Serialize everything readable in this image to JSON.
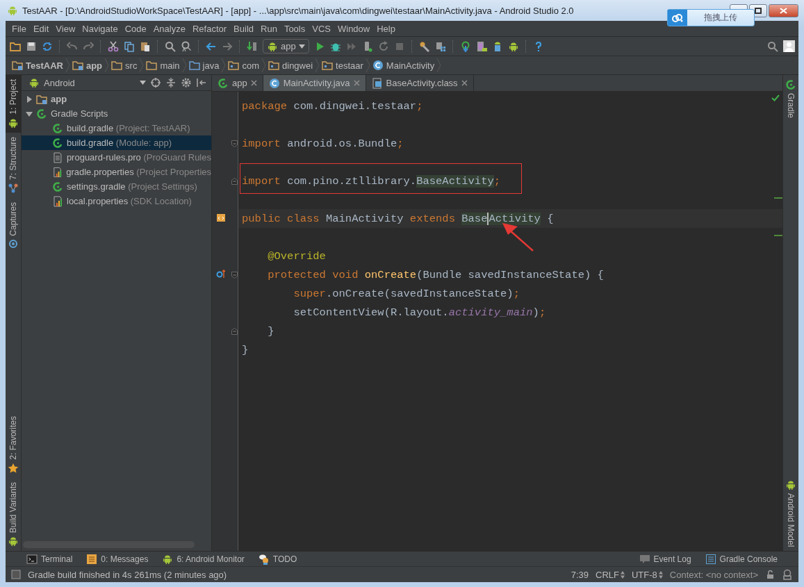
{
  "window": {
    "title": "TestAAR - [D:\\AndroidStudioWorkSpace\\TestAAR] - [app] - ...\\app\\src\\main\\java\\com\\dingwei\\testaar\\MainActivity.java - Android Studio 2.0",
    "upload_button": "拖拽上传"
  },
  "menu": [
    {
      "label": "File"
    },
    {
      "label": "Edit"
    },
    {
      "label": "View"
    },
    {
      "label": "Navigate"
    },
    {
      "label": "Code"
    },
    {
      "label": "Analyze"
    },
    {
      "label": "Refactor"
    },
    {
      "label": "Build"
    },
    {
      "label": "Run"
    },
    {
      "label": "Tools"
    },
    {
      "label": "VCS"
    },
    {
      "label": "Window"
    },
    {
      "label": "Help"
    }
  ],
  "toolbar": {
    "run_config": "app"
  },
  "breadcrumb": [
    {
      "label": "TestAAR",
      "kind": "module"
    },
    {
      "label": "app",
      "kind": "module"
    },
    {
      "label": "src",
      "kind": "folder"
    },
    {
      "label": "main",
      "kind": "folder"
    },
    {
      "label": "java",
      "kind": "source"
    },
    {
      "label": "com",
      "kind": "package"
    },
    {
      "label": "dingwei",
      "kind": "package"
    },
    {
      "label": "testaar",
      "kind": "package"
    },
    {
      "label": "MainActivity",
      "kind": "class"
    }
  ],
  "left_strip": {
    "top": [
      {
        "label": "1: Project",
        "kind": "android",
        "selected": true
      },
      {
        "label": "7: Structure",
        "kind": "structure",
        "selected": false
      },
      {
        "label": "Captures",
        "kind": "captures",
        "selected": false
      }
    ],
    "bottom": [
      {
        "label": "2: Favorites",
        "kind": "star",
        "selected": false
      },
      {
        "label": "Build Variants",
        "kind": "android",
        "selected": false
      }
    ]
  },
  "right_strip": {
    "top": [
      {
        "label": "Gradle",
        "kind": "gradle"
      }
    ],
    "bottom": [
      {
        "label": "Android Model",
        "kind": "android"
      }
    ]
  },
  "project_panel": {
    "view": "Android",
    "tree": [
      {
        "name": "app",
        "kind": "module",
        "expanded": false,
        "selected": false
      },
      {
        "name": "Gradle Scripts",
        "kind": "gradle",
        "expanded": true,
        "selected": false,
        "children": [
          {
            "name": "build.gradle",
            "hint": "(Project: TestAAR)",
            "kind": "gradle",
            "selected": false
          },
          {
            "name": "build.gradle",
            "hint": "(Module: app)",
            "kind": "gradle",
            "selected": true
          },
          {
            "name": "proguard-rules.pro",
            "hint": "(ProGuard Rules",
            "kind": "text",
            "selected": false
          },
          {
            "name": "gradle.properties",
            "hint": "(Project Properties",
            "kind": "properties",
            "selected": false
          },
          {
            "name": "settings.gradle",
            "hint": "(Project Settings)",
            "kind": "gradle",
            "selected": false
          },
          {
            "name": "local.properties",
            "hint": "(SDK Location)",
            "kind": "properties",
            "selected": false
          }
        ]
      }
    ]
  },
  "tabs": [
    {
      "label": "app",
      "kind": "gradle",
      "selected": false
    },
    {
      "label": "MainActivity.java",
      "kind": "class",
      "selected": true
    },
    {
      "label": "BaseActivity.class",
      "kind": "classfile",
      "selected": false
    }
  ],
  "code": [
    {
      "tokens": [
        {
          "text": "package ",
          "kind": "keyword"
        },
        {
          "text": "com.dingwei.testaar",
          "kind": "plain"
        },
        {
          "text": ";",
          "kind": "punct"
        }
      ]
    },
    {
      "blank_before": true,
      "fold_start": true,
      "tokens": [
        {
          "text": "import ",
          "kind": "keyword"
        },
        {
          "text": "android.os.Bundle",
          "kind": "plain"
        },
        {
          "text": ";",
          "kind": "punct"
        }
      ]
    },
    {
      "blank_before": true,
      "fold_end": true,
      "boxed": true,
      "tokens": [
        {
          "text": "import ",
          "kind": "keyword"
        },
        {
          "text": "com.pino.ztllibrary.",
          "kind": "plain"
        },
        {
          "text": "BaseActivity",
          "kind": "ref"
        },
        {
          "text": ";",
          "kind": "punct"
        }
      ]
    },
    {
      "blank_before": true,
      "current": true,
      "implements_marker": true,
      "pointer": true,
      "tokens": [
        {
          "text": "public class ",
          "kind": "keyword"
        },
        {
          "text": "MainActivity ",
          "kind": "plain"
        },
        {
          "text": "extends ",
          "kind": "keyword"
        },
        {
          "text": "Base",
          "kind": "ref"
        },
        {
          "text": "Activity",
          "kind": "ref",
          "caret_before": true
        },
        {
          "text": " {",
          "kind": "plain"
        }
      ]
    },
    {
      "blank_before": true,
      "tokens": [
        {
          "text": "    @Override",
          "kind": "annotation"
        }
      ]
    },
    {
      "fold_start": true,
      "override_marker": true,
      "tokens": [
        {
          "text": "    protected void ",
          "kind": "keyword"
        },
        {
          "text": "onCreate",
          "kind": "method"
        },
        {
          "text": "(Bundle savedInstanceState) {",
          "kind": "plain"
        }
      ]
    },
    {
      "tokens": [
        {
          "text": "        super",
          "kind": "keyword"
        },
        {
          "text": ".onCreate(savedInstanceState)",
          "kind": "plain"
        },
        {
          "text": ";",
          "kind": "punct"
        }
      ]
    },
    {
      "tokens": [
        {
          "text": "        setContentView(R.layout.",
          "kind": "plain"
        },
        {
          "text": "activity_main",
          "kind": "field"
        },
        {
          "text": ")",
          "kind": "plain"
        },
        {
          "text": ";",
          "kind": "punct"
        }
      ]
    },
    {
      "fold_end": true,
      "tokens": [
        {
          "text": "    }",
          "kind": "plain"
        }
      ]
    },
    {
      "tokens": [
        {
          "text": "}",
          "kind": "plain"
        }
      ]
    }
  ],
  "bottom_tabs": {
    "left": [
      {
        "label": "Terminal",
        "kind": "terminal"
      },
      {
        "label": "0: Messages",
        "kind": "messages"
      },
      {
        "label": "6: Android Monitor",
        "kind": "android"
      },
      {
        "label": "TODO",
        "kind": "todo"
      }
    ],
    "right": [
      {
        "label": "Event Log",
        "kind": "eventlog"
      },
      {
        "label": "Gradle Console",
        "kind": "console"
      }
    ]
  },
  "status_bar": {
    "message": "Gradle build finished in 4s 261ms (2 minutes ago)",
    "position": "7:39",
    "line_separator": "CRLF",
    "encoding": "UTF-8",
    "context": "Context: <no context>"
  }
}
